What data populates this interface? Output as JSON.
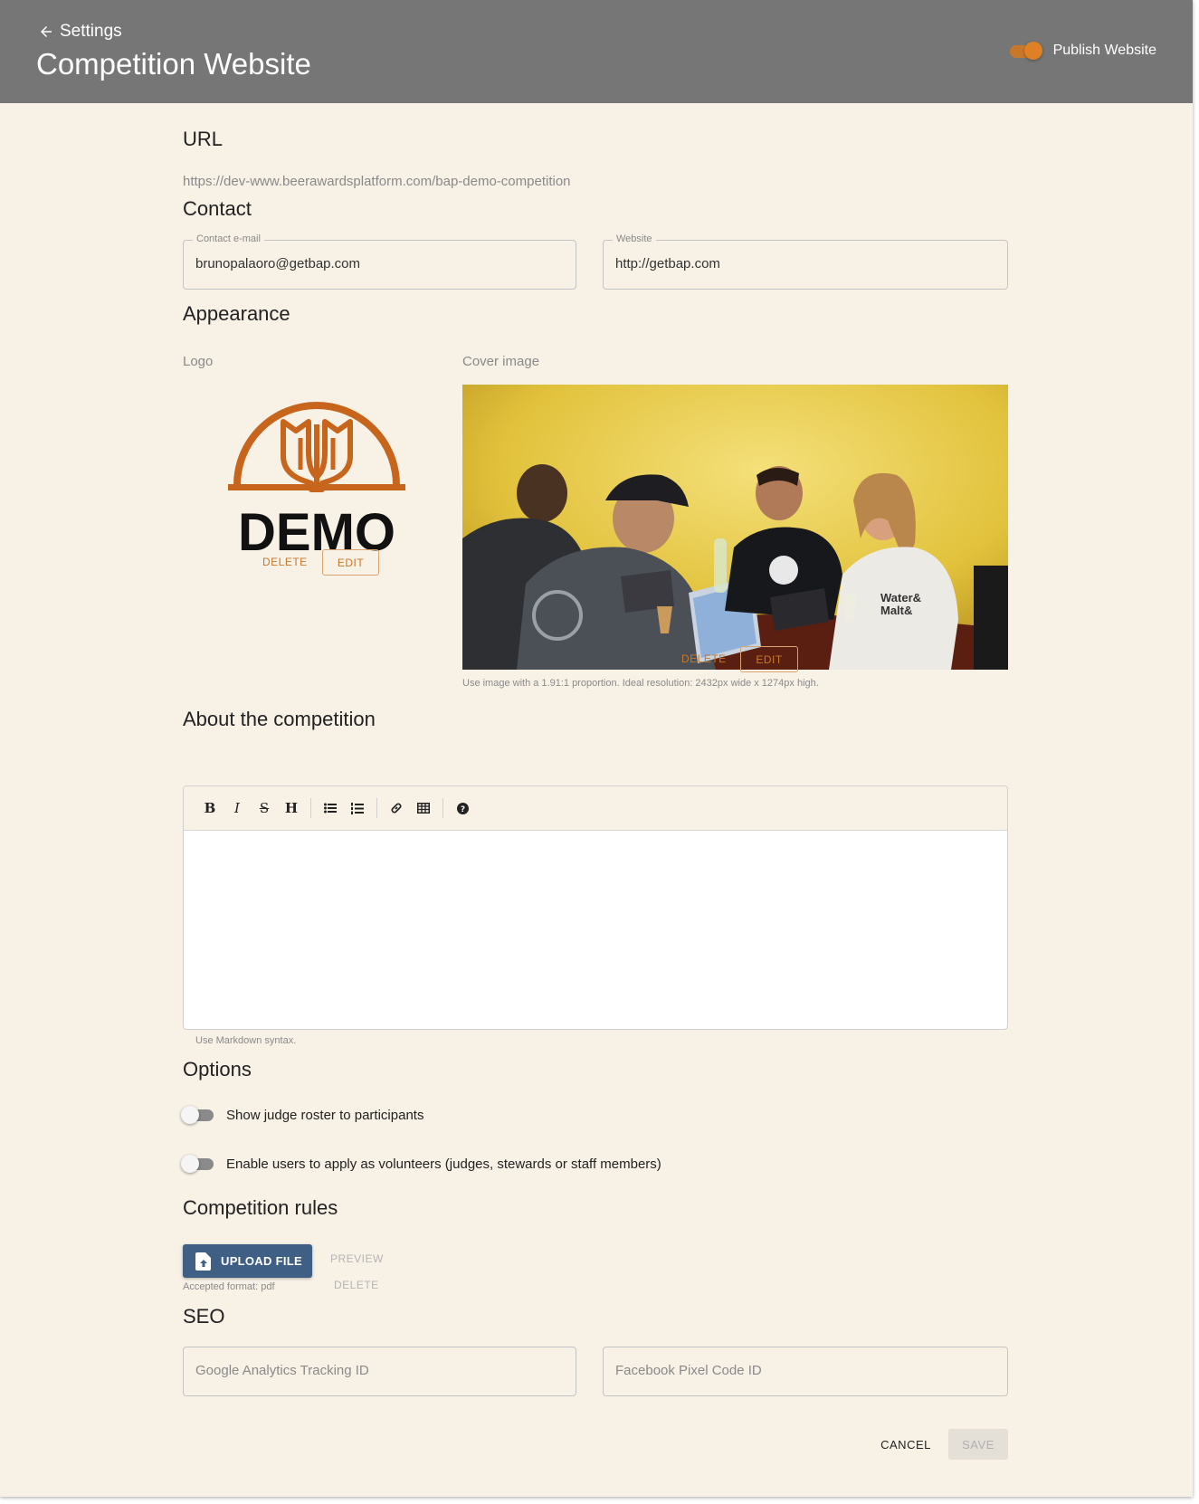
{
  "header": {
    "back_label": "Settings",
    "title": "Competition Website",
    "publish_label": "Publish Website",
    "publish_enabled": true
  },
  "url_section": {
    "title": "URL",
    "value": "https://dev-www.beerawardsplatform.com/bap-demo-competition"
  },
  "contact": {
    "title": "Contact",
    "email_label": "Contact e-mail",
    "email_value": "brunopalaoro@getbap.com",
    "website_label": "Website",
    "website_value": "http://getbap.com"
  },
  "appearance": {
    "title": "Appearance",
    "logo_label": "Logo",
    "logo_text": "DEMO",
    "logo_delete": "DELETE",
    "logo_edit": "EDIT",
    "cover_label": "Cover image",
    "cover_delete": "DELETE",
    "cover_edit": "EDIT",
    "cover_hint": "Use image with a 1.91:1 proportion. Ideal resolution: 2432px wide x 1274px high.",
    "cover_shirt_text_1": "Water&",
    "cover_shirt_text_2": "Malt&"
  },
  "about": {
    "title": "About the competition",
    "toolbar": [
      "bold",
      "italic",
      "strikethrough",
      "heading",
      "bullet-list",
      "numbered-list",
      "link",
      "table",
      "help"
    ],
    "hint": "Use Markdown syntax."
  },
  "options": {
    "title": "Options",
    "items": [
      {
        "label": "Show judge roster to participants",
        "enabled": false
      },
      {
        "label": "Enable users to apply as volunteers (judges, stewards or staff members)",
        "enabled": false
      }
    ]
  },
  "rules": {
    "title": "Competition rules",
    "upload_label": "UPLOAD FILE",
    "format_hint": "Accepted format: pdf",
    "preview_label": "PREVIEW",
    "delete_label": "DELETE"
  },
  "seo": {
    "title": "SEO",
    "ga_placeholder": "Google Analytics Tracking ID",
    "fb_placeholder": "Facebook Pixel Code ID"
  },
  "actions": {
    "cancel_label": "CANCEL",
    "save_label": "SAVE"
  },
  "colors": {
    "header_bg": "#767676",
    "page_bg": "#f7f1e6",
    "accent": "#c8782a",
    "primary_button": "#3f5f85"
  }
}
